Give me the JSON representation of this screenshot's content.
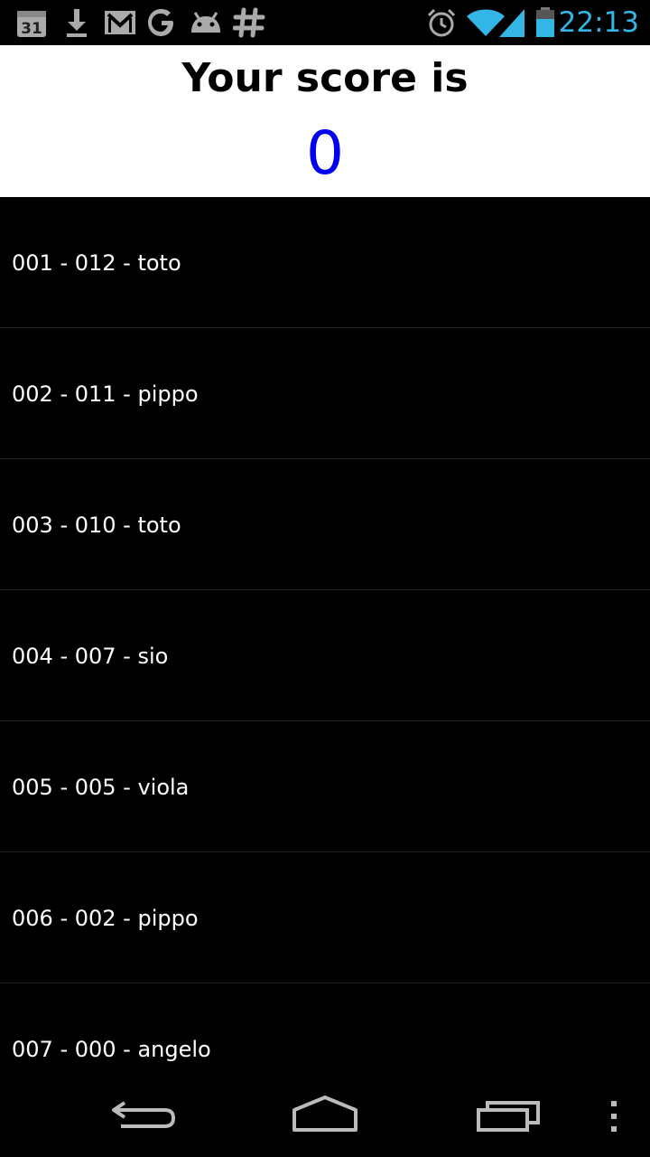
{
  "status_bar": {
    "time": "22:13",
    "calendar_day": "31",
    "icons": [
      "calendar-icon",
      "download-icon",
      "gmail-icon",
      "google-icon",
      "android-icon",
      "hash-icon",
      "alarm-icon",
      "wifi-icon",
      "signal-icon",
      "battery-icon"
    ]
  },
  "header": {
    "title": "Your score is",
    "score": "0"
  },
  "scores": [
    {
      "label": "001 - 012 - toto"
    },
    {
      "label": "002 - 011 - pippo"
    },
    {
      "label": "003 - 010 - toto"
    },
    {
      "label": "004 - 007 - sio"
    },
    {
      "label": "005 - 005 - viola"
    },
    {
      "label": "006 - 002 - pippo"
    },
    {
      "label": "007 - 000 - angelo"
    }
  ],
  "nav": {
    "buttons": [
      "back-icon",
      "home-icon",
      "recents-icon",
      "menu-icon"
    ]
  },
  "colors": {
    "accent": "#33b5e5",
    "score": "#0000ee",
    "background": "#000000",
    "header_bg": "#ffffff"
  }
}
